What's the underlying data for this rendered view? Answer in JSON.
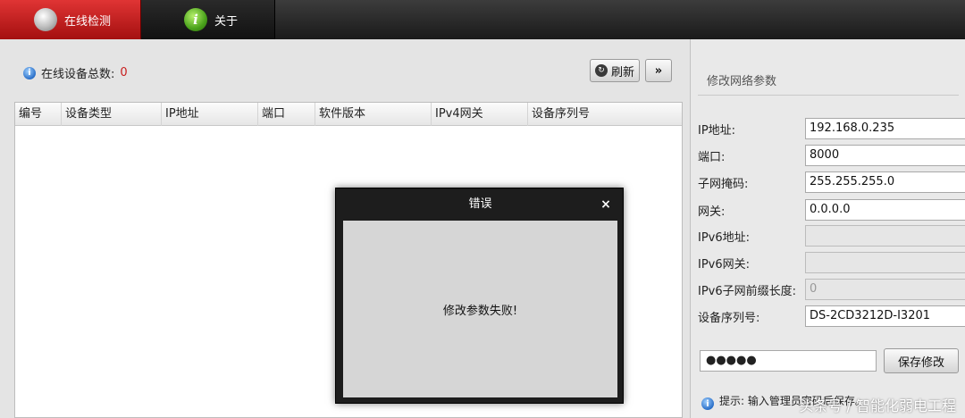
{
  "tabs": {
    "active": {
      "label": "在线检测",
      "icon": "camera-icon"
    },
    "about": {
      "label": "关于",
      "icon": "info-icon",
      "glyph": "i"
    }
  },
  "main": {
    "summary_label": "在线设备总数:",
    "summary_count": "0",
    "refresh_label": "刷新",
    "more_label": "»",
    "columns": [
      "编号",
      "设备类型",
      "IP地址",
      "端口",
      "软件版本",
      "IPv4网关",
      "设备序列号"
    ]
  },
  "panel": {
    "title": "修改网络参数",
    "fields": [
      {
        "label": "IP地址:",
        "value": "192.168.0.235",
        "disabled": false
      },
      {
        "label": "端口:",
        "value": "8000",
        "disabled": false
      },
      {
        "label": "子网掩码:",
        "value": "255.255.255.0",
        "disabled": false
      },
      {
        "label": "网关:",
        "value": "0.0.0.0",
        "disabled": false
      },
      {
        "label": "IPv6地址:",
        "value": "",
        "disabled": true
      },
      {
        "label": "IPv6网关:",
        "value": "",
        "disabled": true
      },
      {
        "label": "IPv6子网前缀长度:",
        "value": "0",
        "disabled": true
      },
      {
        "label": "设备序列号:",
        "value": "DS-2CD3212D-I3201",
        "disabled": false
      }
    ],
    "password_value": "●●●●●",
    "save_label": "保存修改",
    "tip_text": "提示: 输入管理员密码后保存。"
  },
  "dialog": {
    "title": "错误",
    "close_glyph": "×",
    "message": "修改参数失败!"
  },
  "watermark": "头条号 / 智能化弱电工程"
}
